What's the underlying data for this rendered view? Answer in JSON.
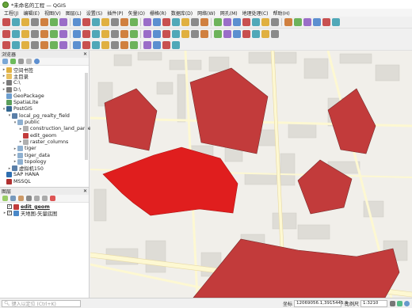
{
  "window": {
    "title": "*未命名的工程 — QGIS"
  },
  "menu": [
    "工程(J)",
    "编辑(E)",
    "视图(V)",
    "图层(L)",
    "设置(S)",
    "插件(P)",
    "矢量(O)",
    "栅格(R)",
    "数据库(D)",
    "网络(W)",
    "网孔(M)",
    "地理处理(C)",
    "帮助(H)"
  ],
  "browser": {
    "title": "浏览器",
    "items": [
      {
        "label": "空间书签",
        "indent": 0,
        "arrow": "▸",
        "icon": "bookmark"
      },
      {
        "label": "主目录",
        "indent": 0,
        "arrow": "▸",
        "icon": "folder"
      },
      {
        "label": "C:\\",
        "indent": 0,
        "arrow": "▸",
        "icon": "drive"
      },
      {
        "label": "D:\\",
        "indent": 0,
        "arrow": "▸",
        "icon": "drive"
      },
      {
        "label": "GeoPackage",
        "indent": 0,
        "arrow": "",
        "icon": "geopackage"
      },
      {
        "label": "SpatiaLite",
        "indent": 0,
        "arrow": "",
        "icon": "spatialite"
      },
      {
        "label": "PostGIS",
        "indent": 0,
        "arrow": "▾",
        "icon": "postgis"
      },
      {
        "label": "local_pg_realty_field",
        "indent": 1,
        "arrow": "▾",
        "icon": "connection"
      },
      {
        "label": "public",
        "indent": 2,
        "arrow": "▾",
        "icon": "schema"
      },
      {
        "label": "construction_land_parcel",
        "indent": 3,
        "arrow": "▸",
        "icon": "table"
      },
      {
        "label": "edit_geom",
        "indent": 3,
        "arrow": "",
        "icon": "polygon"
      },
      {
        "label": "raster_columns",
        "indent": 3,
        "arrow": "▸",
        "icon": "table"
      },
      {
        "label": "tiger",
        "indent": 2,
        "arrow": "▸",
        "icon": "schema"
      },
      {
        "label": "tiger_data",
        "indent": 2,
        "arrow": "▸",
        "icon": "schema"
      },
      {
        "label": "topology",
        "indent": 2,
        "arrow": "▸",
        "icon": "schema"
      },
      {
        "label": "虚拟机150",
        "indent": 1,
        "arrow": "▸",
        "icon": "connection"
      },
      {
        "label": "SAP HANA",
        "indent": 0,
        "arrow": "",
        "icon": "hana"
      },
      {
        "label": "MSSQL",
        "indent": 0,
        "arrow": "",
        "icon": "mssql"
      }
    ]
  },
  "layers": {
    "title": "图层",
    "items": [
      {
        "label": "edit_geom",
        "bold": true,
        "checked": true,
        "icon": "polygon-swatch"
      },
      {
        "label": "天地图-矢量底图",
        "bold": false,
        "checked": true,
        "icon": "raster"
      }
    ]
  },
  "status": {
    "search_placeholder": "键入以定位 (Ctrl+K)",
    "coord_label": "坐标",
    "coord_value": "12069056.1,3915445.9",
    "scale_label": "比例尺",
    "scale_value": "1:3210"
  },
  "colors": {
    "polygon_fill": "#c23b3b",
    "polygon_selected": "#e01e1e",
    "road": "#fdf8d2",
    "building": "#dedcd6"
  },
  "icons": {
    "tb1": [
      "new-icon",
      "open-icon",
      "save-icon",
      "saveas-icon",
      "print-icon",
      "layout-icon",
      "pan-icon",
      "pan-to-selection-icon",
      "zoom-in-icon",
      "zoom-out-icon",
      "zoom-full-icon",
      "zoom-selection-icon",
      "zoom-layer-icon",
      "zoom-native-icon",
      "zoom-last-icon",
      "zoom-next-icon",
      "new-bookmark-icon",
      "show-bookmarks-icon",
      "refresh-icon",
      "identify-icon",
      "select-icon",
      "deselect-icon",
      "attribute-table-icon",
      "field-calc-icon",
      "statistics-icon",
      "measure-icon",
      "annotation-icon",
      "text-icon"
    ]
  }
}
